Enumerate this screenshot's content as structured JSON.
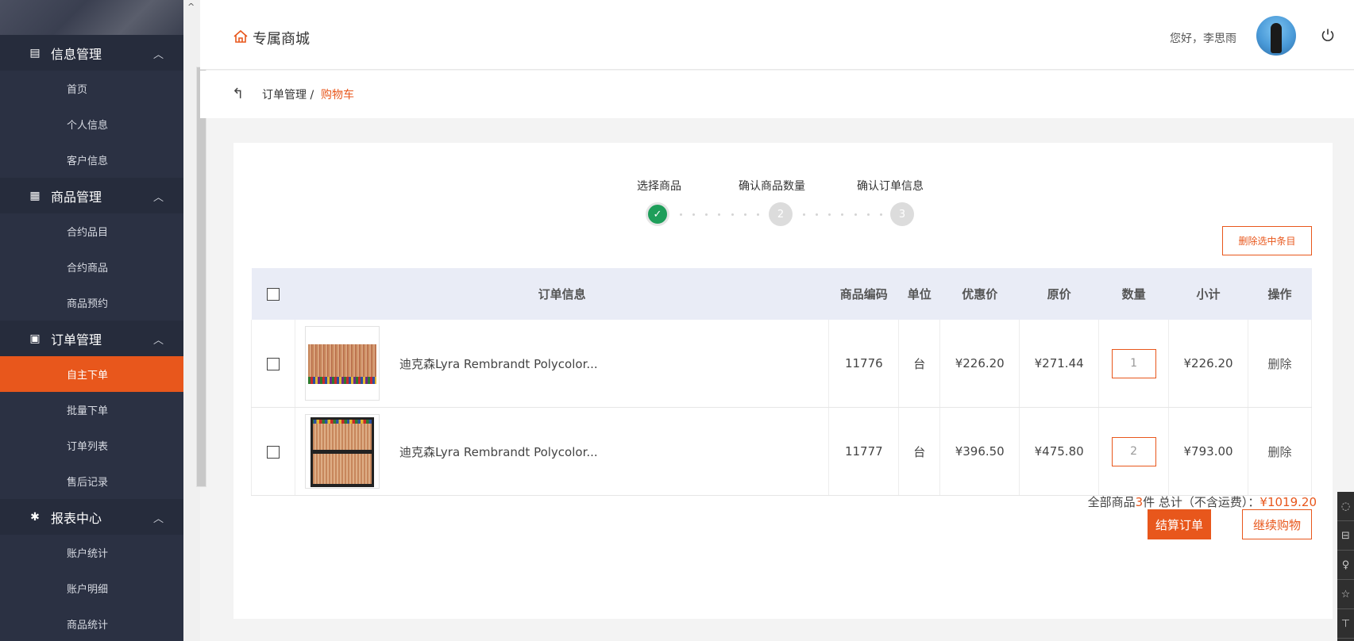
{
  "sidebar": {
    "groups": [
      {
        "title": "信息管理",
        "icon": "info-icon",
        "items": [
          "首页",
          "个人信息",
          "客户信息"
        ]
      },
      {
        "title": "商品管理",
        "icon": "grid-icon",
        "items": [
          "合约品目",
          "合约商品",
          "商品预约"
        ]
      },
      {
        "title": "订单管理",
        "icon": "bag-icon",
        "items": [
          "自主下单",
          "批量下单",
          "订单列表",
          "售后记录"
        ]
      },
      {
        "title": "报表中心",
        "icon": "gear-icon",
        "items": [
          "账户统计",
          "账户明细",
          "商品统计"
        ]
      }
    ],
    "active_item": "自主下单"
  },
  "topbar": {
    "brand": "专属商城",
    "greeting": "您好，李思雨"
  },
  "breadcrumb": {
    "parent": "订单管理 /",
    "current": "购物车"
  },
  "steps": [
    {
      "label": "选择商品",
      "marker": "✓",
      "status": "done"
    },
    {
      "label": "确认商品数量",
      "marker": "2",
      "status": "pending"
    },
    {
      "label": "确认订单信息",
      "marker": "3",
      "status": "pending"
    }
  ],
  "actions": {
    "delete_selected": "删除选中条目",
    "checkout": "结算订单",
    "continue_shopping": "继续购物"
  },
  "table": {
    "headers": [
      "订单信息",
      "商品编码",
      "单位",
      "优惠价",
      "原价",
      "数量",
      "小计",
      "操作"
    ],
    "rows": [
      {
        "name": "迪克森Lyra Rembrandt Polycolor...",
        "code": "11776",
        "unit": "台",
        "discount_price": "¥226.20",
        "original_price": "¥271.44",
        "quantity": "1",
        "subtotal": "¥226.20",
        "action": "删除"
      },
      {
        "name": "迪克森Lyra Rembrandt Polycolor...",
        "code": "11777",
        "unit": "台",
        "discount_price": "¥396.50",
        "original_price": "¥475.80",
        "quantity": "2",
        "subtotal": "¥793.00",
        "action": "删除"
      }
    ]
  },
  "summary": {
    "prefix": "全部商品",
    "count": "3",
    "middle": "件 总计（不含运费）：",
    "total": "¥1019.20"
  },
  "colors": {
    "accent": "#e8571c",
    "sidebar_bg": "#2b3143",
    "success": "#1e9e5a"
  }
}
